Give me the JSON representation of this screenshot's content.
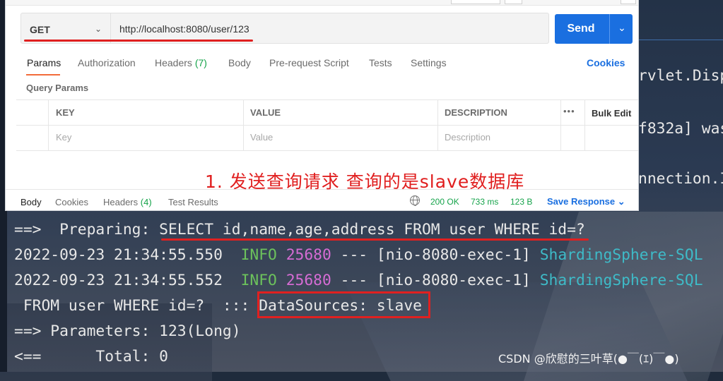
{
  "request": {
    "method": "GET",
    "url": "http://localhost:8080/user/123",
    "send_label": "Send"
  },
  "tabs": [
    {
      "label": "Params"
    },
    {
      "label": "Authorization"
    },
    {
      "label": "Headers",
      "count": "(7)"
    },
    {
      "label": "Body"
    },
    {
      "label": "Pre-request Script"
    },
    {
      "label": "Tests"
    },
    {
      "label": "Settings"
    }
  ],
  "cookies_link": "Cookies",
  "query_params": {
    "title": "Query Params",
    "columns": [
      "KEY",
      "VALUE",
      "DESCRIPTION"
    ],
    "more": "•••",
    "bulk_edit": "Bulk Edit",
    "placeholders": {
      "key": "Key",
      "value": "Value",
      "description": "Description"
    }
  },
  "annotation": "1. 发送查询请求 查询的是slave数据库",
  "response": {
    "tabs": [
      {
        "label": "Body"
      },
      {
        "label": "Cookies"
      },
      {
        "label": "Headers",
        "count": "(4)"
      },
      {
        "label": "Test Results"
      }
    ],
    "status": "200 OK",
    "time": "733 ms",
    "size": "123 B",
    "save_label": "Save Response"
  },
  "console": {
    "peek": [
      "rvlet.Disp",
      "f832a] was",
      "nnection.I"
    ],
    "preparing": "==>  Preparing: SELECT id,name,age,address FROM user WHERE id=?",
    "log_lines": [
      {
        "time": "2022-09-23 21:34:55.550",
        "level": "INFO",
        "pid": "25680",
        "thread": "--- [nio-8080-exec-1]",
        "logger": "ShardingSphere-SQL"
      },
      {
        "time": "2022-09-23 21:34:55.552",
        "level": "INFO",
        "pid": "25680",
        "thread": "--- [nio-8080-exec-1]",
        "logger": "ShardingSphere-SQL"
      }
    ],
    "from_line": " FROM user WHERE id=?  ::: ",
    "datasource": "DataSources: slave",
    "parameters": "==> Parameters: 123(Long)",
    "total": "<==      Total: 0"
  },
  "watermark": "CSDN @欣慰的三叶草(●￣(ｴ)￣●)",
  "colors": {
    "send": "#1a6fe0",
    "annotation": "#e01e1e",
    "info": "#6cc25c",
    "pid": "#d56cd4",
    "logger": "#3ebbc8",
    "status_ok": "#15a34a"
  }
}
